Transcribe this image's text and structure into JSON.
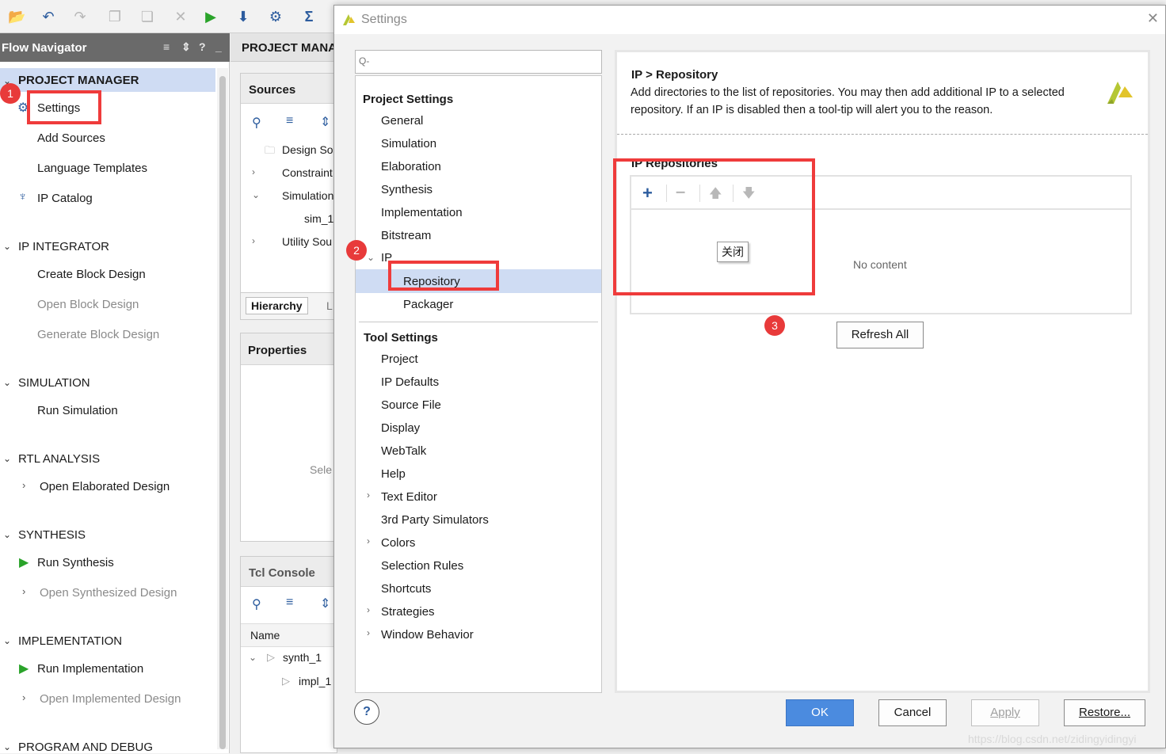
{
  "toolbar": {
    "icons": [
      "open-icon",
      "undo-icon",
      "redo-icon",
      "copy-icon",
      "paste-icon",
      "delete-icon",
      "run-icon",
      "program-icon",
      "settings-icon",
      "sigma-icon"
    ]
  },
  "flow_navigator": {
    "title": "Flow Navigator",
    "controls": [
      "≡",
      "⬍",
      "?",
      "_"
    ],
    "project_manager": {
      "label": "PROJECT MANAGER",
      "items": [
        "Settings",
        "Add Sources",
        "Language Templates",
        "IP Catalog"
      ]
    },
    "ip_integrator": {
      "label": "IP INTEGRATOR",
      "items": [
        "Create Block Design",
        "Open Block Design",
        "Generate Block Design"
      ]
    },
    "simulation": {
      "label": "SIMULATION",
      "items": [
        "Run Simulation"
      ]
    },
    "rtl_analysis": {
      "label": "RTL ANALYSIS",
      "items": [
        "Open Elaborated Design"
      ]
    },
    "synthesis": {
      "label": "SYNTHESIS",
      "items": [
        "Run Synthesis",
        "Open Synthesized Design"
      ]
    },
    "implementation": {
      "label": "IMPLEMENTATION",
      "items": [
        "Run Implementation",
        "Open Implemented Design"
      ]
    },
    "program_debug": {
      "label": "PROGRAM AND DEBUG"
    }
  },
  "middle": {
    "header": "PROJECT MANA",
    "sources": {
      "title": "Sources",
      "tree": [
        "Design So",
        "Constraint",
        "Simulation",
        "sim_1",
        "Utility Sou"
      ],
      "tabs": [
        "Hierarchy",
        "L"
      ]
    },
    "properties": {
      "title": "Properties",
      "placeholder": "Sele"
    },
    "tcl": {
      "title": "Tcl Console",
      "column": "Name",
      "rows": [
        "synth_1",
        "impl_1"
      ]
    }
  },
  "dialog": {
    "title": "Settings",
    "close": "✕",
    "search_placeholder": "Q-",
    "project_settings": {
      "label": "Project Settings",
      "items": [
        "General",
        "Simulation",
        "Elaboration",
        "Synthesis",
        "Implementation",
        "Bitstream",
        "IP"
      ],
      "ip_children": [
        "Repository",
        "Packager"
      ]
    },
    "tool_settings": {
      "label": "Tool Settings",
      "items": [
        "Project",
        "IP Defaults",
        "Source File",
        "Display",
        "WebTalk",
        "Help",
        "Text Editor",
        "3rd Party Simulators",
        "Colors",
        "Selection Rules",
        "Shortcuts",
        "Strategies",
        "Window Behavior"
      ]
    },
    "content": {
      "breadcrumb": "IP > Repository",
      "description_line1": "Add directories to the list of repositories. You may then add additional IP to a selected",
      "description_line2": "repository. If an IP is disabled then a tool-tip will alert you to the reason.",
      "section": "IP Repositories",
      "tooltip": "关闭",
      "empty": "No content",
      "refresh": "Refresh All"
    },
    "buttons": {
      "help": "?",
      "ok": "OK",
      "cancel": "Cancel",
      "apply": "Apply",
      "restore": "Restore..."
    }
  },
  "annotations": {
    "badge1": "1",
    "badge2": "2",
    "badge3": "3"
  },
  "watermark": "https://blog.csdn.net/zidingyidingyi",
  "colors": {
    "selection": "#cfdcf3",
    "accent_blue": "#4b8bdf",
    "annotation_red": "#ef3b3b",
    "run_green": "#2aa32a"
  }
}
